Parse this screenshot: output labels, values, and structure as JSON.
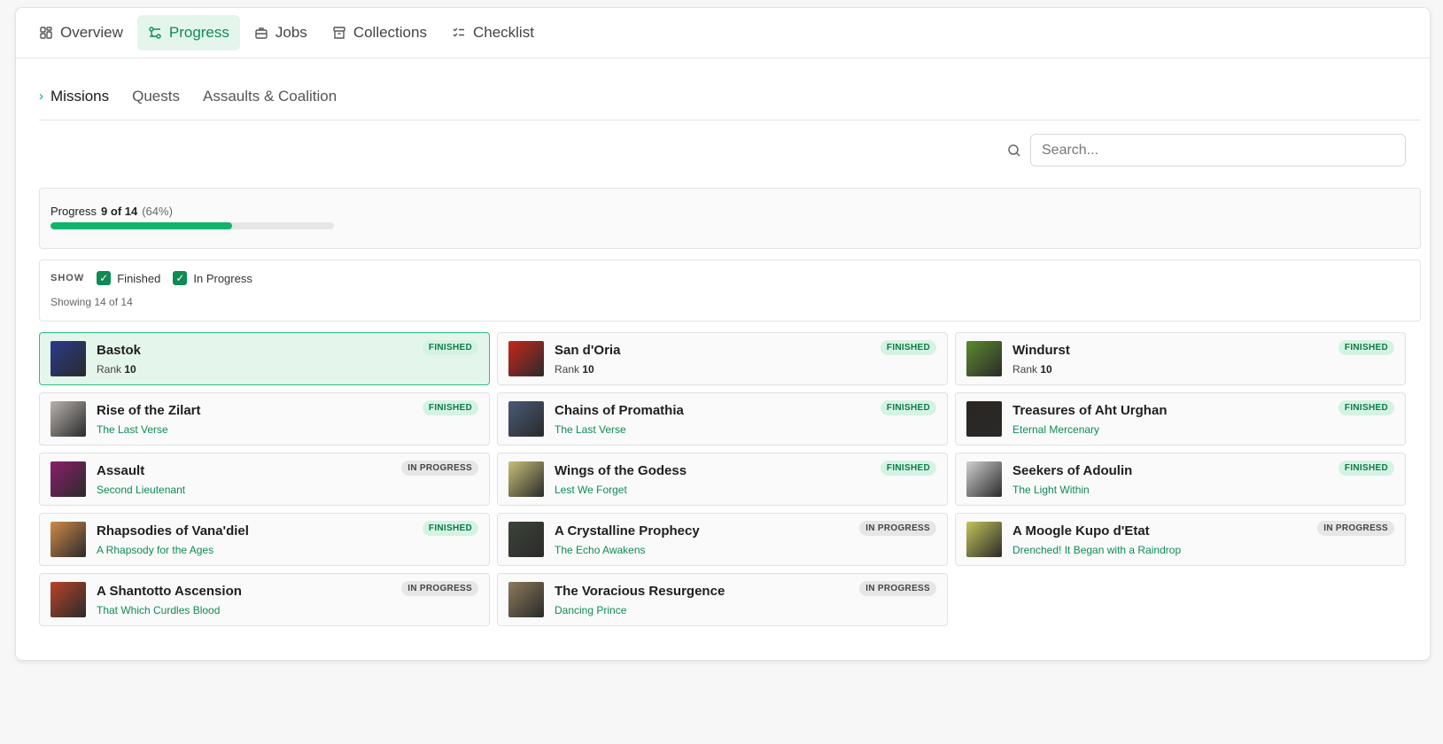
{
  "nav": {
    "tabs": [
      {
        "label": "Overview",
        "icon": "grid-icon"
      },
      {
        "label": "Progress",
        "icon": "sliders-icon"
      },
      {
        "label": "Jobs",
        "icon": "briefcase-icon"
      },
      {
        "label": "Collections",
        "icon": "archive-icon"
      },
      {
        "label": "Checklist",
        "icon": "checklist-icon"
      }
    ],
    "active": "Progress"
  },
  "subtabs": [
    {
      "label": "Missions"
    },
    {
      "label": "Quests"
    },
    {
      "label": "Assaults & Coalition"
    }
  ],
  "search": {
    "placeholder": "Search..."
  },
  "progress": {
    "label": "Progress",
    "count": "9 of 14",
    "percent": "(64%)",
    "fraction": 0.64
  },
  "filters": {
    "show_label": "SHOW",
    "finished_label": "Finished",
    "in_progress_label": "In Progress",
    "showing_text": "Showing 14 of 14"
  },
  "colors": {
    "accent": "#0f8a55",
    "accent_bg": "#e4f6ec",
    "bar": "#11b46a"
  },
  "missions": [
    {
      "title": "Bastok",
      "rank_label": "Rank",
      "rank": "10",
      "status": "FINISHED",
      "thumb": "#2b3a8c"
    },
    {
      "title": "San d'Oria",
      "rank_label": "Rank",
      "rank": "10",
      "status": "FINISHED",
      "thumb": "#c8261d"
    },
    {
      "title": "Windurst",
      "rank_label": "Rank",
      "rank": "10",
      "status": "FINISHED",
      "thumb": "#5e8a2e"
    },
    {
      "title": "Rise of the Zilart",
      "sub": "The Last Verse",
      "status": "FINISHED",
      "thumb": "#b9b3ad"
    },
    {
      "title": "Chains of Promathia",
      "sub": "The Last Verse",
      "status": "FINISHED",
      "thumb": "#4a5a78"
    },
    {
      "title": "Treasures of Aht Urghan",
      "sub": "Eternal Mercenary",
      "status": "FINISHED",
      "thumb": "#2a2520"
    },
    {
      "title": "Assault",
      "sub": "Second Lieutenant",
      "status": "IN PROGRESS",
      "thumb": "#8a1f6a"
    },
    {
      "title": "Wings of the Godess",
      "sub": "Lest We Forget",
      "status": "FINISHED",
      "thumb": "#c9c07a"
    },
    {
      "title": "Seekers of Adoulin",
      "sub": "The Light Within",
      "status": "FINISHED",
      "thumb": "#d0d0d0"
    },
    {
      "title": "Rhapsodies of Vana'diel",
      "sub": "A Rhapsody for the Ages",
      "status": "FINISHED",
      "thumb": "#d08a4a"
    },
    {
      "title": "A Crystalline Prophecy",
      "sub": "The Echo Awakens",
      "status": "IN PROGRESS",
      "thumb": "#3c4438"
    },
    {
      "title": "A Moogle Kupo d'Etat",
      "sub": "Drenched! It Began with a Raindrop",
      "status": "IN PROGRESS",
      "thumb": "#c4c45a"
    },
    {
      "title": "A Shantotto Ascension",
      "sub": "That Which Curdles Blood",
      "status": "IN PROGRESS",
      "thumb": "#b8442a"
    },
    {
      "title": "The Voracious Resurgence",
      "sub": "Dancing Prince",
      "status": "IN PROGRESS",
      "thumb": "#8c7a5a"
    }
  ]
}
